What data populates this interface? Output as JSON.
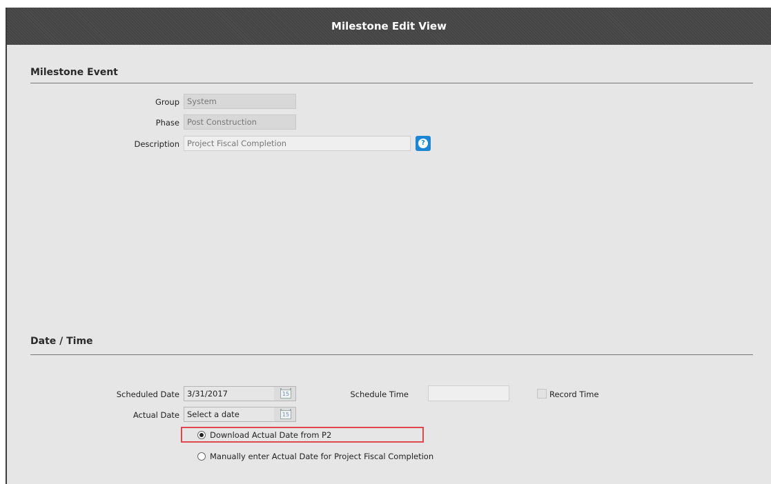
{
  "window": {
    "title": "Milestone Edit View"
  },
  "milestone_event": {
    "heading": "Milestone Event",
    "group_label": "Group",
    "group_value": "System",
    "phase_label": "Phase",
    "phase_value": "Post Construction",
    "description_label": "Description",
    "description_value": "Project Fiscal Completion",
    "help_icon": "help-question-icon"
  },
  "date_time": {
    "heading": "Date / Time",
    "scheduled_date_label": "Scheduled Date",
    "scheduled_date_value": "3/31/2017",
    "actual_date_label": "Actual Date",
    "actual_date_value": "Select a date",
    "calendar_icon_text": "15",
    "schedule_time_label": "Schedule Time",
    "schedule_time_value": "",
    "record_time_label": "Record Time",
    "record_time_checked": false,
    "actual_date_options": [
      {
        "label": "Download Actual Date from P2",
        "selected": true
      },
      {
        "label": "Manually enter Actual Date for Project Fiscal Completion",
        "selected": false
      }
    ]
  },
  "colors": {
    "titlebar": "#454545",
    "help_button": "#1b86d6",
    "highlight": "#e0474c"
  }
}
